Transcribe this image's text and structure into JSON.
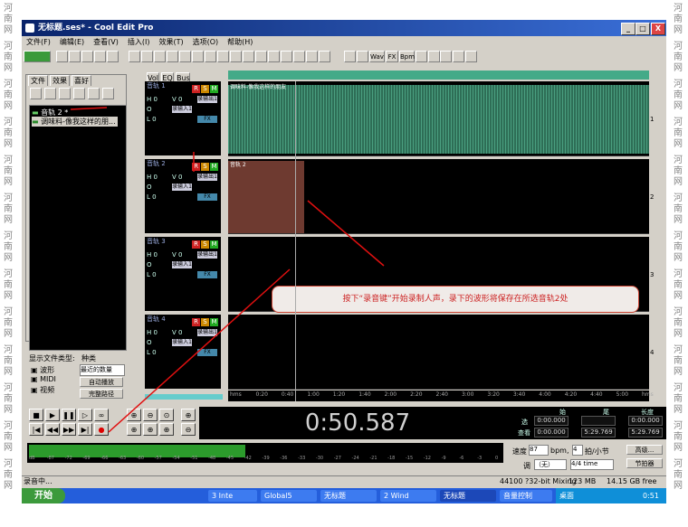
{
  "watermark": {
    "text": "河南网"
  },
  "window": {
    "title": "无标题.ses* - Cool Edit Pro",
    "min": "_",
    "max": "□",
    "close": "X"
  },
  "menu": [
    "文件(F)",
    "编辑(E)",
    "查看(V)",
    "插入(I)",
    "效果(T)",
    "选项(O)",
    "帮助(H)"
  ],
  "toolbar": {
    "wav": "Wav",
    "fx": "FX",
    "bpm": "Bpm",
    "bright_labels": [
      "Wav",
      "FX",
      "Bpm"
    ]
  },
  "left_panel": {
    "tabs": [
      "文件",
      "效果",
      "喜好"
    ],
    "files": [
      {
        "name": "音轨 2 *"
      },
      {
        "name": "调味料-像我这样的朋..."
      }
    ],
    "show_label": "显示文件类型:",
    "sort_label": "种类",
    "types": [
      "波形",
      "MIDI",
      "视频"
    ],
    "sort_value": "最近的数量",
    "btn1": "自动播放",
    "btn2": "完整路径"
  },
  "track_tabs": [
    "Vol",
    "EQ",
    "Bus"
  ],
  "tracks": [
    {
      "name": "音轨 1",
      "h": "H 0",
      "v": "V 0",
      "o": "O",
      "l": "L 0",
      "out": "录输出1",
      "in": "录输入1",
      "fx": "FX",
      "clip": "调味料-像我这样的朋友",
      "lane": "1"
    },
    {
      "name": "音轨 2",
      "h": "H 0",
      "v": "V 0",
      "o": "O",
      "l": "L 0",
      "out": "录输出1",
      "in": "录输入1",
      "fx": "FX",
      "clip": "音轨 2",
      "lane": "2"
    },
    {
      "name": "音轨 3",
      "h": "H 0",
      "v": "V 0",
      "o": "O",
      "l": "L 0",
      "out": "录输出1",
      "in": "录输入1",
      "fx": "FX",
      "lane": "3"
    },
    {
      "name": "音轨 4",
      "h": "H 0",
      "v": "V 0",
      "o": "O",
      "l": "L 0",
      "out": "录输出1",
      "in": "录输入1",
      "fx": "FX",
      "lane": "4"
    }
  ],
  "rsm": {
    "r": "R",
    "s": "S",
    "m": "M"
  },
  "ruler": [
    "hms",
    "0:20",
    "0:40",
    "1:00",
    "1:20",
    "1:40",
    "2:00",
    "2:20",
    "2:40",
    "3:00",
    "3:20",
    "3:40",
    "4:00",
    "4:20",
    "4:40",
    "5:00",
    "hms"
  ],
  "callout": "按下“录音键”开始录制人声，录下的波形将保存在所选音轨2处",
  "time_display": "0:50.587",
  "selection": {
    "h_start": "始",
    "h_end": "尾",
    "h_len": "长度",
    "sel": "选",
    "view": "查看",
    "sel_start": "0:00.000",
    "sel_end": "",
    "sel_len": "0:00.000",
    "view_start": "0:00.000",
    "view_end": "5:29.769",
    "view_len": "5:29.769"
  },
  "tempo": {
    "label": "速度",
    "bpm": "87",
    "bpm_unit": "bpm,",
    "beats": "4",
    "beats_unit": "拍/小节",
    "adv": "高级...",
    "key_label": "调",
    "key": "（无）",
    "time_sig": "4/4 time",
    "metronome": "节拍器"
  },
  "meter_labels": [
    "dB",
    "-87",
    "-72",
    "-69",
    "-66",
    "-63",
    "-60",
    "-57",
    "-54",
    "-51",
    "-48",
    "-45",
    "-42",
    "-39",
    "-36",
    "-33",
    "-30",
    "-27",
    "-24",
    "-21",
    "-18",
    "-15",
    "-12",
    "-9",
    "-6",
    "-3",
    "0"
  ],
  "meter_level": 0.46,
  "status": {
    "left": "录音中...",
    "format": "44100 ?32-bit Mixing",
    "mem": "123 MB",
    "disk": "14.15 GB free"
  },
  "taskbar": {
    "start": "开始",
    "tasks": [
      "3 Inte",
      "Global5",
      "无标题",
      "2 Wind",
      "无标题",
      "音量控制"
    ],
    "tray": "桌面",
    "clock": "0:51"
  }
}
